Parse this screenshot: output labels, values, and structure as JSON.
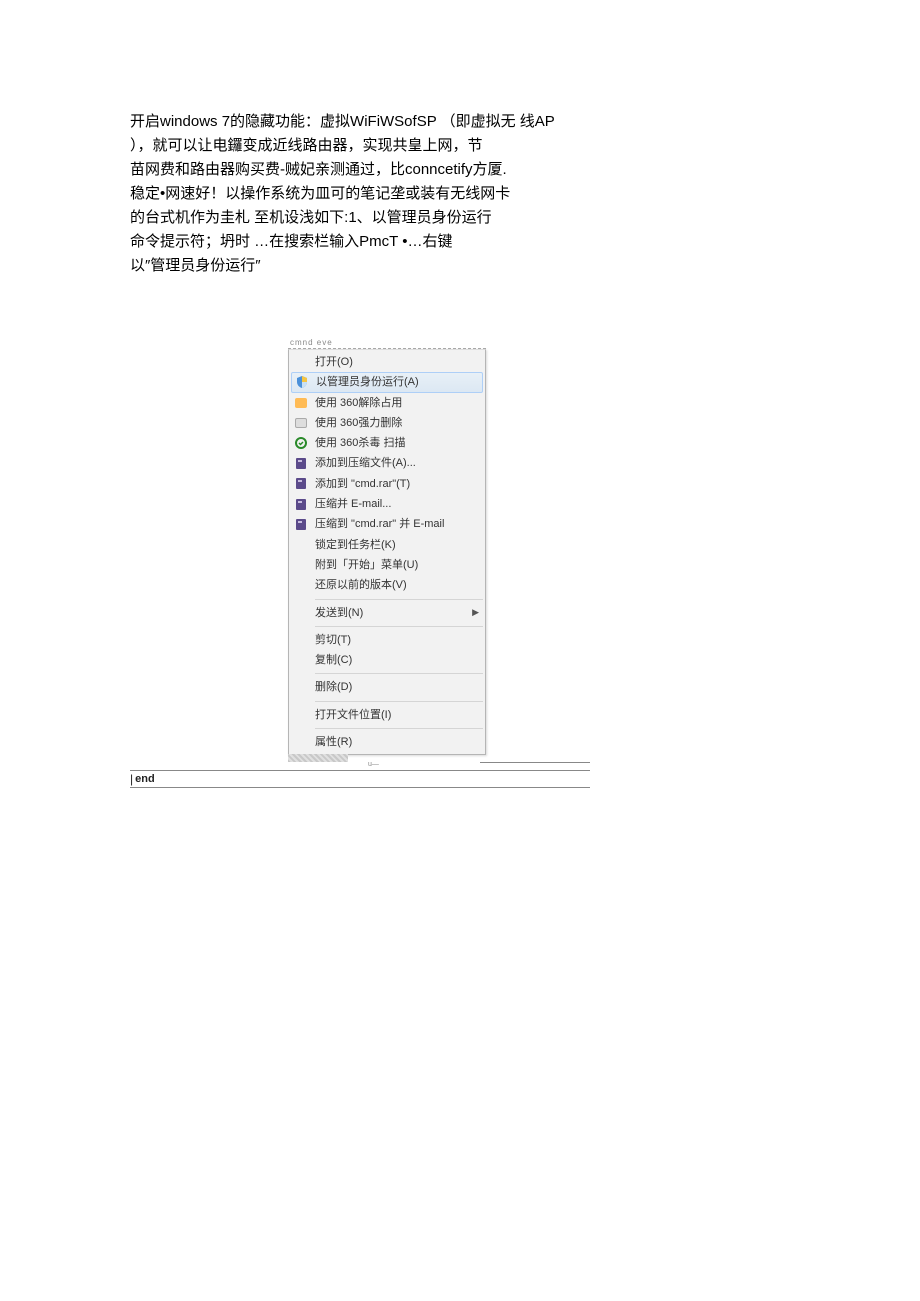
{
  "paragraph": {
    "l1": "开启windows 7的隐藏功能：虚拟WiFiWSofSP （即虚拟无 线AP",
    "l2": "），就可以让电鑼变成近线路由器，实现共皇上网，节",
    "l3": "苗网费和路由器购买费-贼妃亲测通过，比conncetify方厦.",
    "l4": "稳定•网速好！以操作系统为皿可的笔记垄或装有无线网卡",
    "l5": "的台式机作为圭札 至机设浅如下:1、以管理员身份运行",
    "l6": "命令提示符；坍时 …在搜索栏输入PmcT •…右键",
    "l7": "以″管理员身份运行″"
  },
  "menu_header": "cmnd eve",
  "menu": {
    "open": "打开(O)",
    "runas": "以管理员身份运行(A)",
    "unlock360": "使用 360解除占用",
    "force360": "使用 360强力删除",
    "scan360": "使用 360杀毒 扫描",
    "addToArchive": "添加到压缩文件(A)...",
    "addToCmdRar": "添加到 \"cmd.rar\"(T)",
    "compressEmail": "压缩并 E-mail...",
    "compressToEmail": "压缩到 \"cmd.rar\" 并 E-mail",
    "pinTaskbar": "锁定到任务栏(K)",
    "pinStart": "附到「开始」菜单(U)",
    "restore": "还原以前的版本(V)",
    "sendTo": "发送到(N)",
    "cut": "剪切(T)",
    "copy": "复制(C)",
    "delete": "删除(D)",
    "openLocation": "打开文件位置(I)",
    "properties": "属性(R)"
  },
  "footer": {
    "tiny": "u—",
    "end": "end"
  }
}
